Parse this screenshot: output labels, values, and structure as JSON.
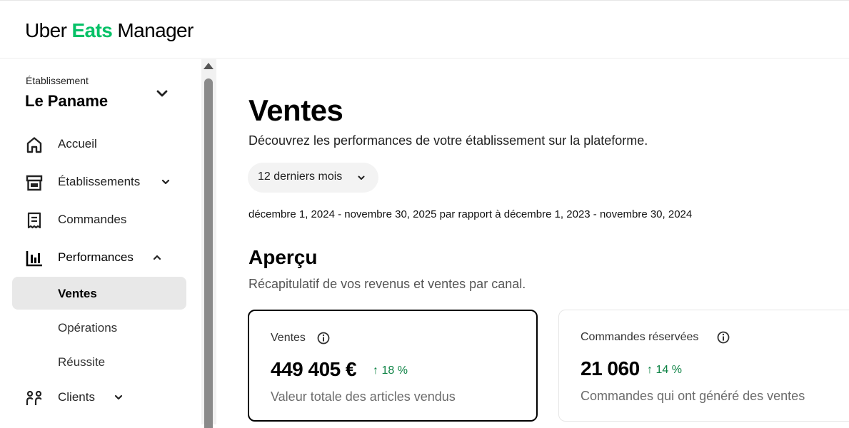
{
  "header": {
    "logo": {
      "uber": "Uber",
      "eats": "Eats",
      "manager": "Manager"
    },
    "colors": {
      "brand_green": "#06c167",
      "delta_green": "#0e8345"
    }
  },
  "sidebar": {
    "establishment_label": "Établissement",
    "establishment_name": "Le Paname",
    "items": [
      {
        "label": "Accueil",
        "icon": "home-icon"
      },
      {
        "label": "Établissements",
        "icon": "store-icon",
        "chevron": "chevron-down-icon"
      },
      {
        "label": "Commandes",
        "icon": "receipt-icon"
      },
      {
        "label": "Performances",
        "icon": "bar-chart-icon",
        "chevron": "chevron-up-icon"
      },
      {
        "label": "Clients",
        "icon": "users-icon",
        "chevron": "chevron-down-icon"
      }
    ],
    "performance_subitems": [
      {
        "label": "Ventes",
        "active": true
      },
      {
        "label": "Opérations",
        "active": false
      },
      {
        "label": "Réussite",
        "active": false
      }
    ]
  },
  "main": {
    "title": "Ventes",
    "subtitle": "Découvrez les performances de votre établissement sur la plateforme.",
    "period_selector": "12 derniers mois",
    "date_range": "décembre 1, 2024 - novembre 30, 2025 par rapport à décembre 1, 2023 - novembre 30, 2024",
    "overview": {
      "title": "Aperçu",
      "subtitle": "Récapitulatif de vos revenus et ventes par canal."
    },
    "cards": [
      {
        "title": "Ventes",
        "value": "449 405 €",
        "delta": "18 %",
        "description": "Valeur totale des articles vendus",
        "selected": true
      },
      {
        "title": "Commandes réservées",
        "value": "21 060",
        "delta": "14 %",
        "description": "Commandes qui ont généré des ventes",
        "selected": false
      }
    ]
  }
}
